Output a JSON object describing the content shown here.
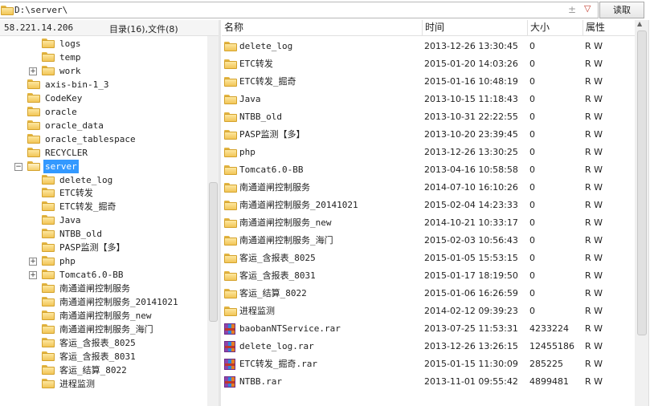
{
  "address_bar": {
    "path": "D:\\server\\",
    "read_label": "读取"
  },
  "left_panel": {
    "ip": "58.221.14.206",
    "counts": "目录(16),文件(8)"
  },
  "tree": [
    {
      "label": "logs",
      "indent": 2,
      "exp": ""
    },
    {
      "label": "temp",
      "indent": 2,
      "exp": ""
    },
    {
      "label": "work",
      "indent": 2,
      "exp": "+"
    },
    {
      "label": "axis-bin-1_3",
      "indent": 1,
      "exp": ""
    },
    {
      "label": "CodeKey",
      "indent": 1,
      "exp": ""
    },
    {
      "label": "oracle",
      "indent": 1,
      "exp": ""
    },
    {
      "label": "oracle_data",
      "indent": 1,
      "exp": ""
    },
    {
      "label": "oracle_tablespace",
      "indent": 1,
      "exp": ""
    },
    {
      "label": "RECYCLER",
      "indent": 1,
      "exp": ""
    },
    {
      "label": "server",
      "indent": 1,
      "exp": "−",
      "selected": true
    },
    {
      "label": "delete_log",
      "indent": 2,
      "exp": ""
    },
    {
      "label": "ETC转发",
      "indent": 2,
      "exp": ""
    },
    {
      "label": "ETC转发_掘奇",
      "indent": 2,
      "exp": ""
    },
    {
      "label": "Java",
      "indent": 2,
      "exp": ""
    },
    {
      "label": "NTBB_old",
      "indent": 2,
      "exp": ""
    },
    {
      "label": "PASP监测【多】",
      "indent": 2,
      "exp": ""
    },
    {
      "label": "php",
      "indent": 2,
      "exp": "+"
    },
    {
      "label": "Tomcat6.0-BB",
      "indent": 2,
      "exp": "+"
    },
    {
      "label": "南通道闸控制服务",
      "indent": 2,
      "exp": ""
    },
    {
      "label": "南通道闸控制服务_20141021",
      "indent": 2,
      "exp": ""
    },
    {
      "label": "南通道闸控制服务_new",
      "indent": 2,
      "exp": ""
    },
    {
      "label": "南通道闸控制服务_海门",
      "indent": 2,
      "exp": ""
    },
    {
      "label": "客运_含报表_8025",
      "indent": 2,
      "exp": ""
    },
    {
      "label": "客运_含报表_8031",
      "indent": 2,
      "exp": ""
    },
    {
      "label": "客运_结算_8022",
      "indent": 2,
      "exp": ""
    },
    {
      "label": "进程监测",
      "indent": 2,
      "exp": ""
    }
  ],
  "file_list": {
    "columns": {
      "name": "名称",
      "time": "时间",
      "size": "大小",
      "attr": "属性"
    },
    "rows": [
      {
        "name": "delete_log",
        "time": "2013-12-26 13:30:45",
        "size": "0",
        "attr": "R W",
        "type": "folder"
      },
      {
        "name": "ETC转发",
        "time": "2015-01-20 14:03:26",
        "size": "0",
        "attr": "R W",
        "type": "folder"
      },
      {
        "name": "ETC转发_掘奇",
        "time": "2015-01-16 10:48:19",
        "size": "0",
        "attr": "R W",
        "type": "folder"
      },
      {
        "name": "Java",
        "time": "2013-10-15 11:18:43",
        "size": "0",
        "attr": "R W",
        "type": "folder"
      },
      {
        "name": "NTBB_old",
        "time": "2013-10-31 22:22:55",
        "size": "0",
        "attr": "R W",
        "type": "folder"
      },
      {
        "name": "PASP监测【多】",
        "time": "2013-10-20 23:39:45",
        "size": "0",
        "attr": "R W",
        "type": "folder"
      },
      {
        "name": "php",
        "time": "2013-12-26 13:30:25",
        "size": "0",
        "attr": "R W",
        "type": "folder"
      },
      {
        "name": "Tomcat6.0-BB",
        "time": "2013-04-16 10:58:58",
        "size": "0",
        "attr": "R W",
        "type": "folder"
      },
      {
        "name": "南通道闸控制服务",
        "time": "2014-07-10 16:10:26",
        "size": "0",
        "attr": "R W",
        "type": "folder"
      },
      {
        "name": "南通道闸控制服务_20141021",
        "time": "2015-02-04 14:23:33",
        "size": "0",
        "attr": "R W",
        "type": "folder"
      },
      {
        "name": "南通道闸控制服务_new",
        "time": "2014-10-21 10:33:17",
        "size": "0",
        "attr": "R W",
        "type": "folder"
      },
      {
        "name": "南通道闸控制服务_海门",
        "time": "2015-02-03 10:56:43",
        "size": "0",
        "attr": "R W",
        "type": "folder"
      },
      {
        "name": "客运_含报表_8025",
        "time": "2015-01-05 15:53:15",
        "size": "0",
        "attr": "R W",
        "type": "folder"
      },
      {
        "name": "客运_含报表_8031",
        "time": "2015-01-17 18:19:50",
        "size": "0",
        "attr": "R W",
        "type": "folder"
      },
      {
        "name": "客运_结算_8022",
        "time": "2015-01-06 16:26:59",
        "size": "0",
        "attr": "R W",
        "type": "folder"
      },
      {
        "name": "进程监测",
        "time": "2014-02-12 09:39:23",
        "size": "0",
        "attr": "R W",
        "type": "folder"
      },
      {
        "name": "baobanNTService.rar",
        "time": "2013-07-25 11:53:31",
        "size": "4233224",
        "attr": "R W",
        "type": "rar"
      },
      {
        "name": "delete_log.rar",
        "time": "2013-12-26 13:26:15",
        "size": "12455186",
        "attr": "R W",
        "type": "rar"
      },
      {
        "name": "ETC转发_掘奇.rar",
        "time": "2015-01-15 11:30:09",
        "size": "285225",
        "attr": "R W",
        "type": "rar"
      },
      {
        "name": "NTBB.rar",
        "time": "2013-11-01 09:55:42",
        "size": "4899481",
        "attr": "R W",
        "type": "rar"
      }
    ]
  },
  "icons": {
    "folder": "folder-icon",
    "rar": "rar-archive-icon",
    "dropdown": "chevron-down-icon",
    "add": "plus-icon"
  }
}
